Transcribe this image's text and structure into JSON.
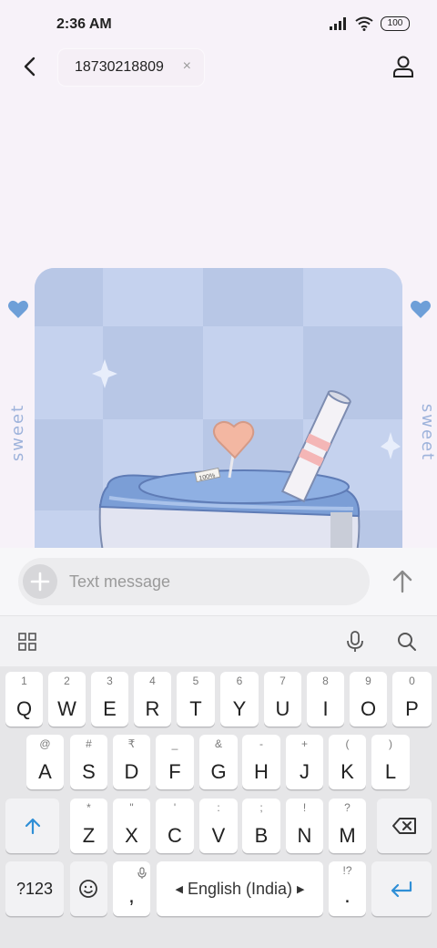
{
  "status_bar": {
    "time": "2:36 AM",
    "battery": "100"
  },
  "header": {
    "recipient": "18730218809",
    "chip_close": "×"
  },
  "sticker": {
    "side_text": "sweet",
    "lollipop_tag": "100%"
  },
  "composer": {
    "placeholder": "Text message"
  },
  "keyboard": {
    "row1": [
      {
        "key": "Q",
        "hint": "1"
      },
      {
        "key": "W",
        "hint": "2"
      },
      {
        "key": "E",
        "hint": "3"
      },
      {
        "key": "R",
        "hint": "4"
      },
      {
        "key": "T",
        "hint": "5"
      },
      {
        "key": "Y",
        "hint": "6"
      },
      {
        "key": "U",
        "hint": "7"
      },
      {
        "key": "I",
        "hint": "8"
      },
      {
        "key": "O",
        "hint": "9"
      },
      {
        "key": "P",
        "hint": "0"
      }
    ],
    "row2": [
      {
        "key": "A",
        "hint": "@"
      },
      {
        "key": "S",
        "hint": "#"
      },
      {
        "key": "D",
        "hint": "₹"
      },
      {
        "key": "F",
        "hint": "_"
      },
      {
        "key": "G",
        "hint": "&"
      },
      {
        "key": "H",
        "hint": "-"
      },
      {
        "key": "J",
        "hint": "+"
      },
      {
        "key": "K",
        "hint": "("
      },
      {
        "key": "L",
        "hint": ")"
      }
    ],
    "row3": [
      {
        "key": "Z",
        "hint": "*"
      },
      {
        "key": "X",
        "hint": "\""
      },
      {
        "key": "C",
        "hint": "'"
      },
      {
        "key": "V",
        "hint": ":"
      },
      {
        "key": "B",
        "hint": ";"
      },
      {
        "key": "N",
        "hint": "!"
      },
      {
        "key": "M",
        "hint": "?"
      }
    ],
    "symbols_key": "?123",
    "comma_key": ",",
    "period_key": ".",
    "period_hint": "!?",
    "space_label": "English (India)"
  },
  "colors": {
    "accent": "#2f8fd6",
    "card_bg": "#c3d0ea",
    "card_dark": "#b8c7e4"
  },
  "icons": [
    "back-arrow-icon",
    "contact-icon",
    "signal-icon",
    "wifi-icon",
    "plus-icon",
    "send-arrow-icon",
    "grid-icon",
    "mic-icon",
    "search-icon",
    "shift-icon",
    "backspace-icon",
    "emoji-icon",
    "enter-icon"
  ]
}
